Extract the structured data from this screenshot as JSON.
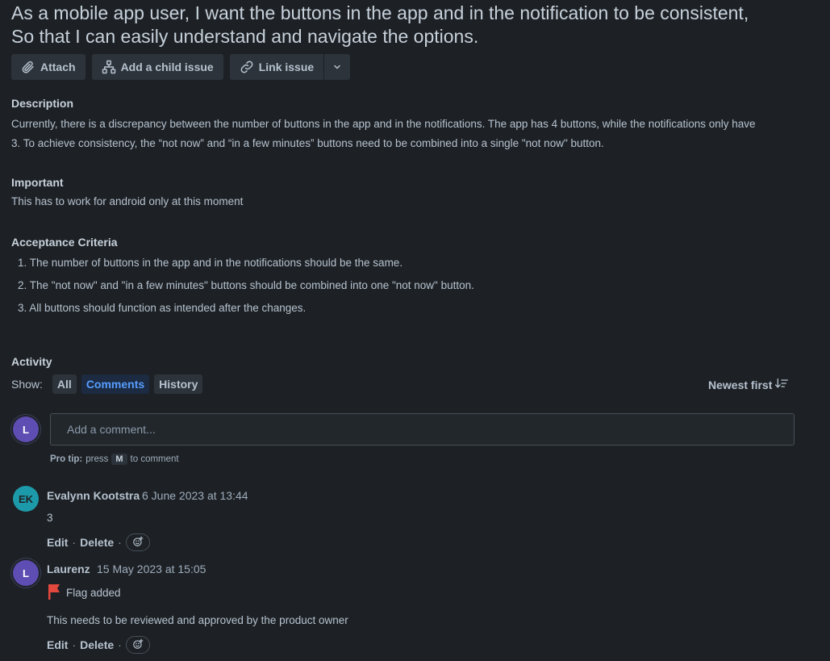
{
  "issue": {
    "title_line1": "As a mobile app user, I want the buttons in the app and in the notification to be consistent,",
    "title_line2": "So that I can easily understand and navigate the options."
  },
  "toolbar": {
    "attach": "Attach",
    "child_issue": "Add a child issue",
    "link_issue": "Link issue"
  },
  "description": {
    "heading": "Description",
    "line1": "Currently, there is a discrepancy between the number of buttons in the app and in the notifications. The app has 4 buttons, while the notifications only have",
    "line2": "3. To achieve consistency, the “not now” and “in a few minutes” buttons need to be combined into a single \"not now\" button."
  },
  "important": {
    "heading": "Important",
    "text": "This has to work for android only at this moment"
  },
  "acceptance": {
    "heading": "Acceptance Criteria",
    "items": [
      "1. The number of buttons in the app and in the notifications should be the same.",
      "2. The \"not now\" and \"in a few minutes\" buttons should be combined into one \"not now\" button.",
      "3. All buttons should function as intended after the changes."
    ]
  },
  "activity": {
    "heading": "Activity",
    "show_label": "Show:",
    "filters": [
      "All",
      "Comments",
      "History"
    ],
    "sort_label": "Newest first",
    "current_user_initial": "L",
    "comment_placeholder": "Add a comment...",
    "protip_label": "Pro tip:",
    "protip_press": "press",
    "protip_key": "M",
    "protip_suffix": "to comment"
  },
  "comments": [
    {
      "initials": "EK",
      "author": "Evalynn Kootstra",
      "date": "6 June 2023 at 13:44",
      "body": "3",
      "edit": "Edit",
      "delete": "Delete"
    },
    {
      "initials": "L",
      "author": "Laurenz",
      "date": "15 May 2023 at 15:05",
      "flag_text": "Flag added",
      "body": "This needs to be reviewed and approved by the product owner",
      "edit": "Edit",
      "delete": "Delete"
    }
  ],
  "colors": {
    "background": "#1d2125",
    "accent": "#579dff",
    "flag": "#e2483d",
    "avatar_l": "#5e4db2",
    "avatar_ek": "#1d9aaa"
  },
  "icons": [
    "paperclip-icon",
    "hierarchy-icon",
    "link-icon",
    "chevron-down-icon",
    "sort-icon",
    "emoji-icon",
    "flag-icon"
  ]
}
